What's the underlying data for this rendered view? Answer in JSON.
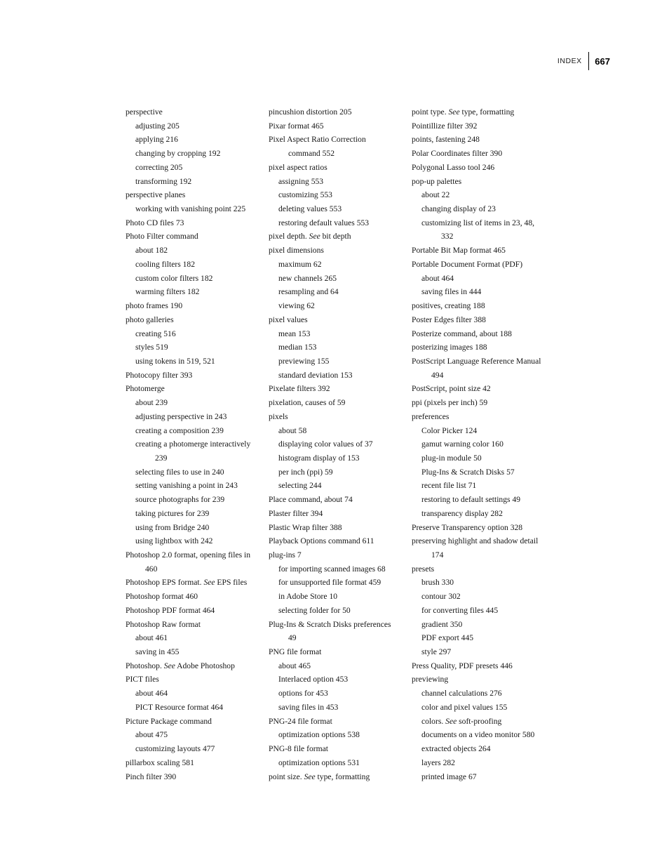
{
  "page": {
    "folio": "667",
    "running_head": "INDEX",
    "rule_color": "#000000"
  },
  "columns": [
    {
      "name": "column-1",
      "entries": [
        {
          "level": 1,
          "text": "perspective"
        },
        {
          "level": 2,
          "text": "adjusting 205"
        },
        {
          "level": 2,
          "text": "applying 216"
        },
        {
          "level": 2,
          "text": "changing by cropping 192"
        },
        {
          "level": 2,
          "text": "correcting 205"
        },
        {
          "level": 2,
          "text": "transforming 192"
        },
        {
          "level": 1,
          "text": "perspective planes"
        },
        {
          "level": 2,
          "text": "working with vanishing point 225"
        },
        {
          "level": 1,
          "text": "Photo CD files 73"
        },
        {
          "level": 1,
          "text": "Photo Filter command"
        },
        {
          "level": 2,
          "text": "about 182"
        },
        {
          "level": 2,
          "text": "cooling filters 182"
        },
        {
          "level": 2,
          "text": "custom color filters 182"
        },
        {
          "level": 2,
          "text": "warming filters 182"
        },
        {
          "level": 1,
          "text": "photo frames 190"
        },
        {
          "level": 1,
          "text": "photo galleries"
        },
        {
          "level": 2,
          "text": "creating 516"
        },
        {
          "level": 2,
          "text": "styles 519"
        },
        {
          "level": 2,
          "text": "using tokens in 519, 521"
        },
        {
          "level": 1,
          "text": "Photocopy filter 393"
        },
        {
          "level": 1,
          "text": "Photomerge"
        },
        {
          "level": 2,
          "text": "about 239"
        },
        {
          "level": 2,
          "text": "adjusting perspective in 243"
        },
        {
          "level": 2,
          "text": "creating a composition 239"
        },
        {
          "level": 2,
          "wrap": true,
          "text": "creating a photomerge interactively 239"
        },
        {
          "level": 2,
          "text": "selecting files to use in 240"
        },
        {
          "level": 2,
          "text": "setting vanishing a point in 243"
        },
        {
          "level": 2,
          "text": "source photographs for 239"
        },
        {
          "level": 2,
          "text": "taking pictures for 239"
        },
        {
          "level": 2,
          "text": "using from Bridge 240"
        },
        {
          "level": 2,
          "text": "using lightbox with 242"
        },
        {
          "level": 1,
          "wrap": true,
          "text": "Photoshop 2.0 format, opening files in 460"
        },
        {
          "level": 1,
          "text": "Photoshop EPS format. ",
          "see": "See",
          "text_after": " EPS files"
        },
        {
          "level": 1,
          "text": "Photoshop format 460"
        },
        {
          "level": 1,
          "text": "Photoshop PDF format 464"
        },
        {
          "level": 1,
          "text": "Photoshop Raw format"
        },
        {
          "level": 2,
          "text": "about 461"
        },
        {
          "level": 2,
          "text": "saving in 455"
        },
        {
          "level": 1,
          "text": "Photoshop. ",
          "see": "See",
          "text_after": " Adobe Photoshop"
        },
        {
          "level": 1,
          "text": "PICT files"
        },
        {
          "level": 2,
          "text": "about 464"
        },
        {
          "level": 2,
          "text": "PICT Resource format 464"
        },
        {
          "level": 1,
          "text": "Picture Package command"
        },
        {
          "level": 2,
          "text": "about 475"
        },
        {
          "level": 2,
          "text": "customizing layouts 477"
        },
        {
          "level": 1,
          "text": "pillarbox scaling 581"
        },
        {
          "level": 1,
          "text": "Pinch filter 390"
        }
      ]
    },
    {
      "name": "column-2",
      "entries": [
        {
          "level": 1,
          "text": "pincushion distortion 205"
        },
        {
          "level": 1,
          "text": "Pixar format 465"
        },
        {
          "level": 1,
          "wrap": true,
          "text": "Pixel Aspect Ratio Correction command 552"
        },
        {
          "level": 1,
          "text": "pixel aspect ratios"
        },
        {
          "level": 2,
          "text": "assigning 553"
        },
        {
          "level": 2,
          "text": "customizing 553"
        },
        {
          "level": 2,
          "text": "deleting values 553"
        },
        {
          "level": 2,
          "text": "restoring default values 553"
        },
        {
          "level": 1,
          "text": "pixel depth. ",
          "see": "See",
          "text_after": " bit depth"
        },
        {
          "level": 1,
          "text": "pixel dimensions"
        },
        {
          "level": 2,
          "text": "maximum 62"
        },
        {
          "level": 2,
          "text": "new channels 265"
        },
        {
          "level": 2,
          "text": "resampling and 64"
        },
        {
          "level": 2,
          "text": "viewing 62"
        },
        {
          "level": 1,
          "text": "pixel values"
        },
        {
          "level": 2,
          "text": "mean 153"
        },
        {
          "level": 2,
          "text": "median 153"
        },
        {
          "level": 2,
          "text": "previewing 155"
        },
        {
          "level": 2,
          "text": "standard deviation 153"
        },
        {
          "level": 1,
          "text": "Pixelate filters 392"
        },
        {
          "level": 1,
          "text": "pixelation, causes of 59"
        },
        {
          "level": 1,
          "text": "pixels"
        },
        {
          "level": 2,
          "text": "about 58"
        },
        {
          "level": 2,
          "text": "displaying color values of 37"
        },
        {
          "level": 2,
          "text": "histogram display of 153"
        },
        {
          "level": 2,
          "text": "per inch (ppi) 59"
        },
        {
          "level": 2,
          "text": "selecting 244"
        },
        {
          "level": 1,
          "text": "Place command, about 74"
        },
        {
          "level": 1,
          "text": "Plaster filter 394"
        },
        {
          "level": 1,
          "text": "Plastic Wrap filter 388"
        },
        {
          "level": 1,
          "text": "Playback Options command 611"
        },
        {
          "level": 1,
          "text": "plug-ins 7"
        },
        {
          "level": 2,
          "text": "for importing scanned images 68"
        },
        {
          "level": 2,
          "text": "for unsupported file format 459"
        },
        {
          "level": 2,
          "text": "in Adobe Store 10"
        },
        {
          "level": 2,
          "text": "selecting folder for 50"
        },
        {
          "level": 1,
          "wrap": true,
          "text": "Plug-Ins & Scratch Disks preferences 49"
        },
        {
          "level": 1,
          "text": "PNG file format"
        },
        {
          "level": 2,
          "text": "about 465"
        },
        {
          "level": 2,
          "text": "Interlaced option 453"
        },
        {
          "level": 2,
          "text": "options for 453"
        },
        {
          "level": 2,
          "text": "saving files in 453"
        },
        {
          "level": 1,
          "text": "PNG-24 file format"
        },
        {
          "level": 2,
          "text": "optimization options 538"
        },
        {
          "level": 1,
          "text": "PNG-8 file format"
        },
        {
          "level": 2,
          "text": "optimization options 531"
        },
        {
          "level": 1,
          "text": "point size. ",
          "see": "See",
          "text_after": " type, formatting"
        }
      ]
    },
    {
      "name": "column-3",
      "entries": [
        {
          "level": 1,
          "text": "point type. ",
          "see": "See",
          "text_after": " type, formatting"
        },
        {
          "level": 1,
          "text": "Pointillize filter 392"
        },
        {
          "level": 1,
          "text": "points, fastening 248"
        },
        {
          "level": 1,
          "text": "Polar Coordinates filter 390"
        },
        {
          "level": 1,
          "text": "Polygonal Lasso tool 246"
        },
        {
          "level": 1,
          "text": "pop-up palettes"
        },
        {
          "level": 2,
          "text": "about 22"
        },
        {
          "level": 2,
          "text": "changing display of 23"
        },
        {
          "level": 2,
          "wrap": true,
          "text": "customizing list of items in 23, 48, 332"
        },
        {
          "level": 1,
          "text": "Portable Bit Map format 465"
        },
        {
          "level": 1,
          "text": "Portable Document Format (PDF)"
        },
        {
          "level": 2,
          "text": "about 464"
        },
        {
          "level": 2,
          "text": "saving files in 444"
        },
        {
          "level": 1,
          "text": "positives, creating 188"
        },
        {
          "level": 1,
          "text": "Poster Edges filter 388"
        },
        {
          "level": 1,
          "text": "Posterize command, about 188"
        },
        {
          "level": 1,
          "text": "posterizing images 188"
        },
        {
          "level": 1,
          "wrap": true,
          "text": "PostScript Language Reference Manual 494"
        },
        {
          "level": 1,
          "text": "PostScript, point size 42"
        },
        {
          "level": 1,
          "text": "ppi (pixels per inch) 59"
        },
        {
          "level": 1,
          "text": "preferences"
        },
        {
          "level": 2,
          "text": "Color Picker 124"
        },
        {
          "level": 2,
          "text": "gamut warning color 160"
        },
        {
          "level": 2,
          "text": "plug-in module 50"
        },
        {
          "level": 2,
          "text": "Plug-Ins & Scratch Disks 57"
        },
        {
          "level": 2,
          "text": "recent file list 71"
        },
        {
          "level": 2,
          "text": "restoring to default settings 49"
        },
        {
          "level": 2,
          "text": "transparency display 282"
        },
        {
          "level": 1,
          "text": "Preserve Transparency option 328"
        },
        {
          "level": 1,
          "wrap": true,
          "text": "preserving highlight and shadow detail 174"
        },
        {
          "level": 1,
          "text": "presets"
        },
        {
          "level": 2,
          "text": "brush 330"
        },
        {
          "level": 2,
          "text": "contour 302"
        },
        {
          "level": 2,
          "text": "for converting files 445"
        },
        {
          "level": 2,
          "text": "gradient 350"
        },
        {
          "level": 2,
          "text": "PDF export 445"
        },
        {
          "level": 2,
          "text": "style 297"
        },
        {
          "level": 1,
          "text": "Press Quality, PDF presets 446"
        },
        {
          "level": 1,
          "text": "previewing"
        },
        {
          "level": 2,
          "text": "channel calculations 276"
        },
        {
          "level": 2,
          "text": "color and pixel values 155"
        },
        {
          "level": 2,
          "text": "colors. ",
          "see": "See",
          "text_after": " soft-proofing"
        },
        {
          "level": 2,
          "text": "documents on a video monitor 580"
        },
        {
          "level": 2,
          "text": "extracted objects 264"
        },
        {
          "level": 2,
          "text": "layers 282"
        },
        {
          "level": 2,
          "text": "printed image 67"
        }
      ]
    }
  ]
}
